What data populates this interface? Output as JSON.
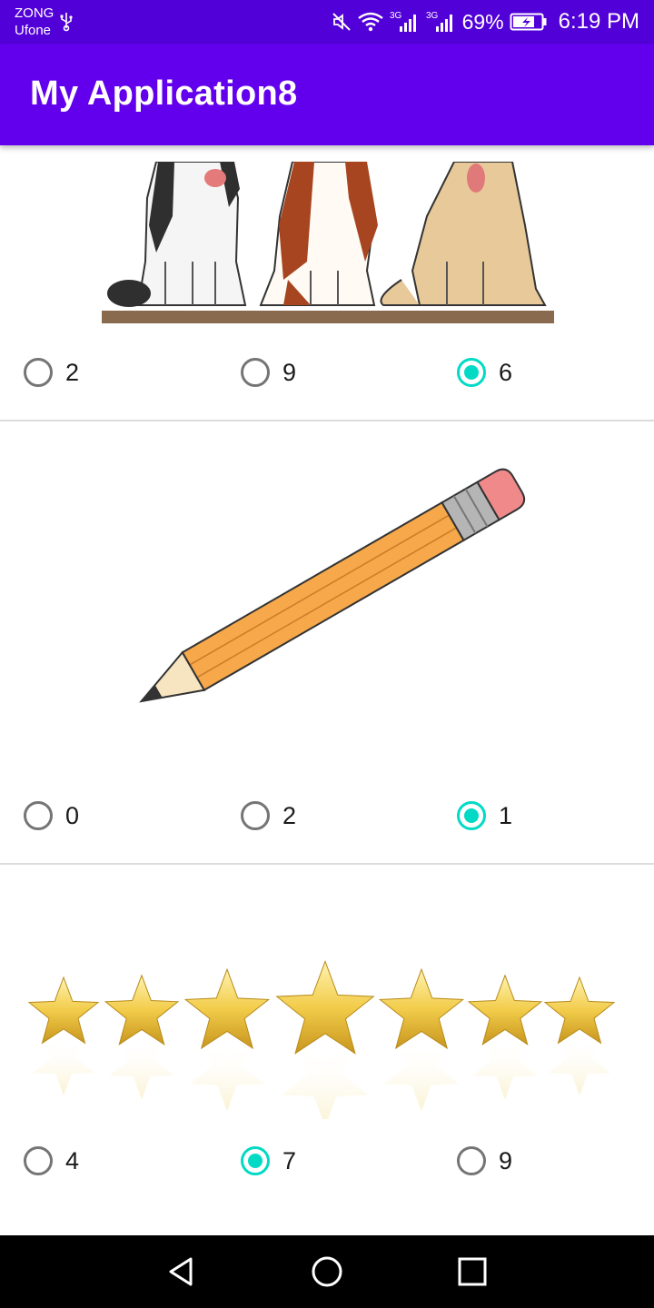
{
  "status_bar": {
    "carrier_1": "ZONG",
    "carrier_2": "Ufone",
    "network_1": "3G",
    "network_2": "3G",
    "battery": "69%",
    "time": "6:19 PM"
  },
  "app_bar": {
    "title": "My Application8"
  },
  "questions": [
    {
      "image": "dogs",
      "options": [
        {
          "label": "2",
          "checked": false
        },
        {
          "label": "9",
          "checked": false
        },
        {
          "label": "6",
          "checked": true
        }
      ]
    },
    {
      "image": "pencil",
      "options": [
        {
          "label": "0",
          "checked": false
        },
        {
          "label": "2",
          "checked": false
        },
        {
          "label": "1",
          "checked": true
        }
      ]
    },
    {
      "image": "stars",
      "options": [
        {
          "label": "4",
          "checked": false
        },
        {
          "label": "7",
          "checked": true
        },
        {
          "label": "9",
          "checked": false
        }
      ]
    }
  ],
  "colors": {
    "app_bar": "#6200ee",
    "status_bar": "#5200d8",
    "radio_checked": "#03dac5",
    "radio_unchecked": "#757575"
  },
  "icons": {
    "usb": "usb-icon",
    "mute": "mute-icon",
    "wifi": "wifi-icon",
    "signal": "signal-icon",
    "battery": "battery-icon",
    "back": "back-icon",
    "home": "home-icon",
    "recents": "recents-icon"
  }
}
